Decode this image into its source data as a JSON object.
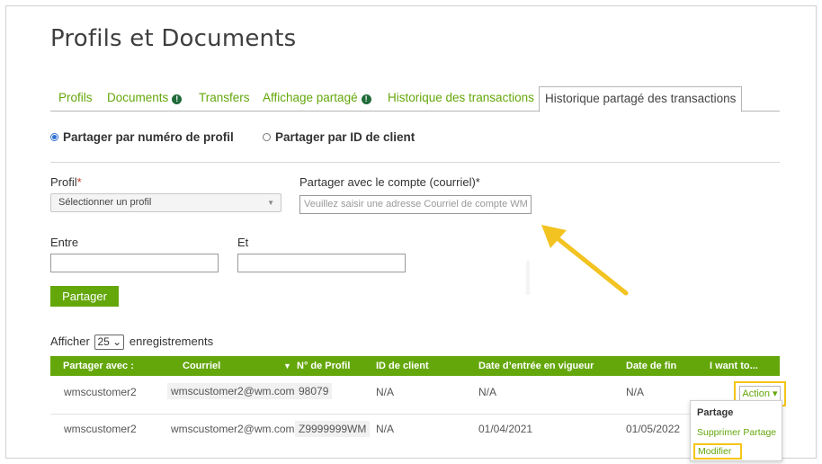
{
  "page": {
    "title": "Profils et Documents"
  },
  "tabs": [
    {
      "label": "Profils",
      "has_info": false
    },
    {
      "label": "Documents",
      "has_info": true
    },
    {
      "label": "Transfers",
      "has_info": false
    },
    {
      "label": "Affichage partagé",
      "has_info": true
    },
    {
      "label": "Historique des transactions",
      "has_info": false
    },
    {
      "label": "Historique partagé des transactions",
      "has_info": false,
      "active": true
    }
  ],
  "share_mode": {
    "options": [
      {
        "label": "Partager par numéro de profil",
        "checked": true
      },
      {
        "label": "Partager par ID de client",
        "checked": false
      }
    ]
  },
  "form": {
    "profil_label": "Profil",
    "profil_required": "*",
    "profil_select_value": "Sélectionner un profil",
    "email_label": "Partager avec le compte (courriel)*",
    "email_placeholder": "Veuillez saisir une adresse Courriel de compte WM",
    "entre_label": "Entre",
    "et_label": "Et",
    "submit_label": "Partager"
  },
  "table_controls": {
    "afficher_label": "Afficher",
    "page_size": "25",
    "enregistrements_label": "enregistrements"
  },
  "table": {
    "columns": [
      "Partager avec :",
      "Courriel",
      "▼",
      "N° de Profil",
      "ID de client",
      "Date d’entrée en vigueur",
      "Date de fin",
      "I want to..."
    ],
    "rows": [
      {
        "partager_avec": "wmscustomer2",
        "courriel": "wmscustomer2@wm.com",
        "profil": "98079",
        "client_id": "N/A",
        "date_debut": "N/A",
        "date_fin": "N/A"
      },
      {
        "partager_avec": "wmscustomer2",
        "courriel": "wmscustomer2@wm.com",
        "profil": "Z9999999WM",
        "client_id": "N/A",
        "date_debut": "01/04/2021",
        "date_fin": "01/05/2022"
      }
    ]
  },
  "action_menu": {
    "button_label": "Action ▾",
    "header": "Partage",
    "items": [
      "Supprimer Partage",
      "Modifier"
    ]
  },
  "colors": {
    "accent": "#64a70b",
    "highlight": "#f5c518",
    "info_icon": "#1f6b3a"
  }
}
